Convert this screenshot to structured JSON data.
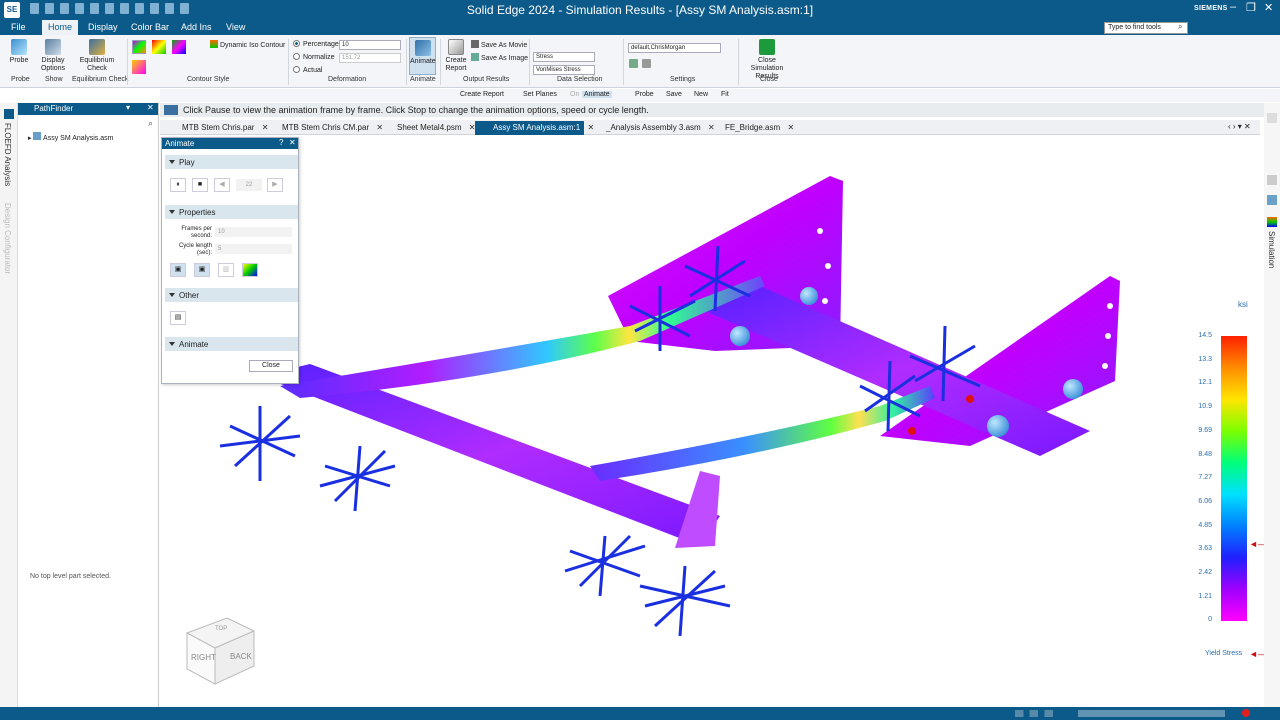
{
  "app": {
    "title": "Solid Edge 2024 - Simulation Results - [Assy SM Analysis.asm:1]",
    "brand": "SIEMENS",
    "icon": "SE"
  },
  "menu": [
    "File",
    "Home",
    "Display",
    "Color Bar",
    "Add Ins",
    "View"
  ],
  "search": {
    "placeholder": "Type to find tools"
  },
  "ribbon": {
    "probe": "Probe",
    "display_options": "Display Options",
    "equilibrium_check": "Equilibrium Check",
    "dynamic_iso": "Dynamic Iso Contour",
    "percentage": "Percentage",
    "percentage_val": "10",
    "normalize": "Normalize",
    "normalize_val": "151.72",
    "actual": "Actual",
    "animate": "Animate",
    "create_report": "Create Report",
    "save_movie": "Save As Movie",
    "save_image": "Save As Image",
    "result_type": "Stress",
    "result_component": "VonMises Stress",
    "settings_val": "default,ChrisMorgan",
    "close_results": "Close Simulation Results",
    "groups": {
      "probe": "Probe",
      "show": "Show",
      "eq": "Equilibrium Check",
      "contour": "Contour Style",
      "deformation": "Deformation",
      "animate": "Animate",
      "output": "Output Results",
      "data": "Data Selection",
      "settings": "Settings",
      "close": "Close"
    }
  },
  "cmdbar": [
    "Create Report",
    "Set Planes",
    "On",
    "Animate",
    "Probe",
    "Save",
    "New",
    "Fit"
  ],
  "prompt": "Click Pause to view the animation frame by frame. Click Stop to change the animation options, speed or cycle length.",
  "pathfinder": {
    "title": "PathFinder",
    "item": "Assy SM Analysis.asm",
    "message": "No top level part selected."
  },
  "leftstrip": [
    "FLOEFD Analysis",
    "Design Configurator"
  ],
  "rightstrip": [
    "Simulation"
  ],
  "tabs": [
    "MTB Stem Chris.par",
    "MTB Stem Chris CM.par",
    "Sheet Metal4.psm",
    "Assy SM Analysis.asm:1",
    "_Analysis Assembly 3.asm",
    "FE_Bridge.asm"
  ],
  "dialog": {
    "title": "Animate",
    "play": "Play",
    "frame": "22",
    "properties": "Properties",
    "fps_label": "Frames per second:",
    "fps": "10",
    "cycle_label": "Cycle length (sec):",
    "cycle": "5",
    "other": "Other",
    "animate": "Animate",
    "close": "Close"
  },
  "legend": {
    "unit": "ksi",
    "ticks": [
      "14.5",
      "13.3",
      "12.1",
      "10.9",
      "9.69",
      "8.48",
      "7.27",
      "6.06",
      "4.85",
      "3.63",
      "2.42",
      "1.21",
      "0"
    ],
    "yield": "Yield Stress"
  },
  "viewcube": {
    "front": "RIGHT",
    "side": "BACK",
    "top": "TOP"
  }
}
